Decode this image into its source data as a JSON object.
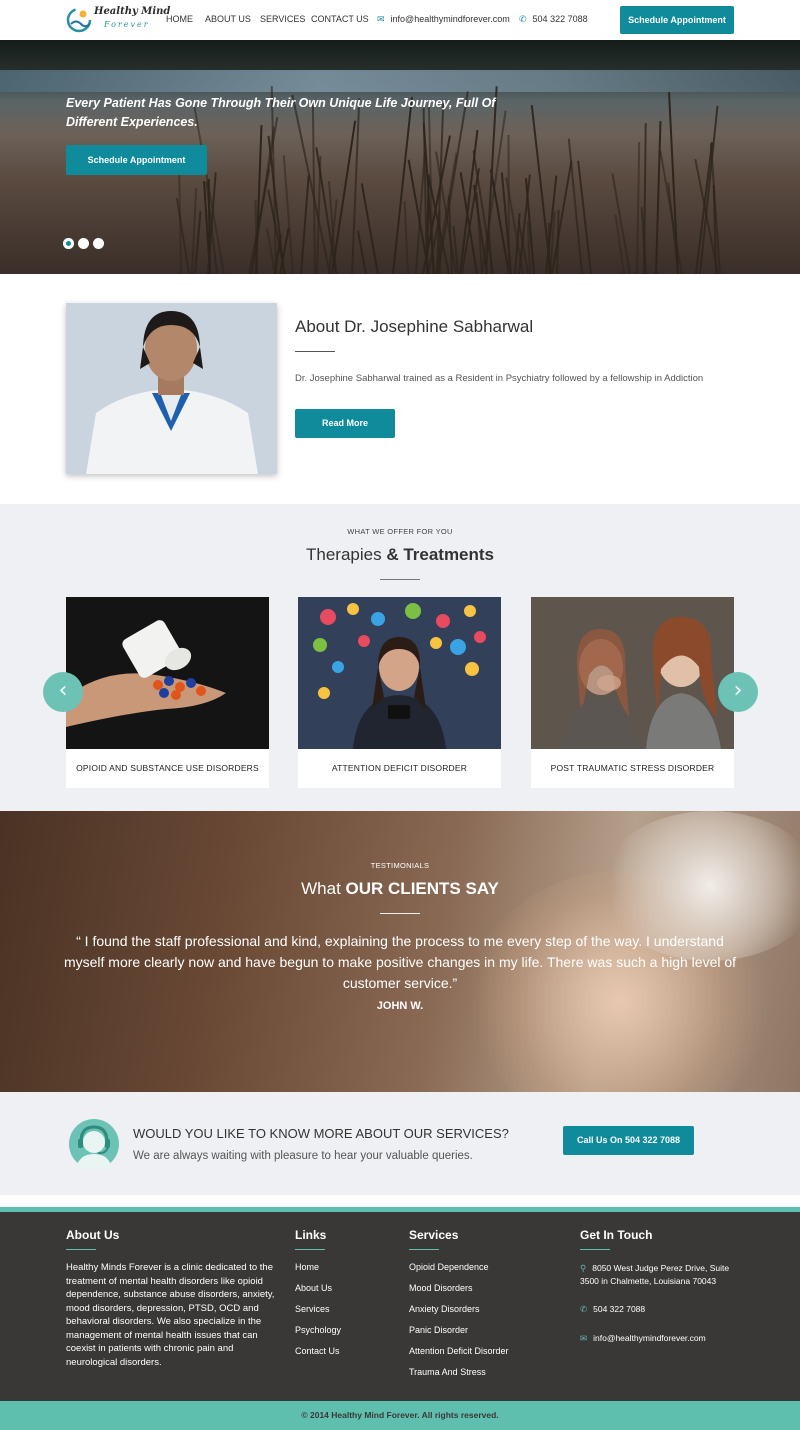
{
  "brand": {
    "line1": "Healthy Mind",
    "line2": "Forever"
  },
  "nav": {
    "links": [
      "HOME",
      "ABOUT US",
      "SERVICES",
      "CONTACT US"
    ],
    "email": "info@healthymindforever.com",
    "phone": "504 322 7088",
    "cta": "Schedule Appointment"
  },
  "hero": {
    "title": "Every Patient Has Gone Through Their Own Unique Life Journey, Full Of Different Experiences.",
    "cta": "Schedule Appointment",
    "slides": 3,
    "active_slide": 1
  },
  "about": {
    "title": "About Dr. Josephine Sabharwal",
    "text": "Dr. Josephine Sabharwal trained as a Resident in Psychiatry followed by a fellowship in Addiction",
    "cta": "Read More"
  },
  "therapies": {
    "kicker": "WHAT WE OFFER FOR YOU",
    "title_light": "Therapies ",
    "title_bold": "& Treatments",
    "cards": [
      {
        "label": "OPIOID AND SUBSTANCE USE DISORDERS"
      },
      {
        "label": "ATTENTION DEFICIT DISORDER"
      },
      {
        "label": "POST TRAUMATIC STRESS DISORDER"
      }
    ]
  },
  "testimonials": {
    "kicker": "TESTIMONIALS",
    "title_light": "What ",
    "title_bold": "OUR CLIENTS SAY",
    "quote": "“ I found the staff professional and kind, explaining the process to me every step of the way. I understand myself more clearly now and have begun to make positive changes in my life. There was such a high level of customer service.”",
    "author": "JOHN W."
  },
  "cta_strip": {
    "question": "WOULD YOU LIKE TO KNOW MORE ABOUT OUR SERVICES?",
    "sub": "We are always waiting with pleasure to hear your valuable queries.",
    "button": "Call Us On 504 322 7088"
  },
  "footer": {
    "about_head": "About Us",
    "about_text": "Healthy Minds Forever is a clinic dedicated to the treatment of mental health disorders like opioid dependence, substance abuse disorders, anxiety, mood disorders, depression, PTSD, OCD and behavioral disorders. We also specialize in the management of mental health issues that can coexist in patients with chronic pain and neurological disorders.",
    "links_head": "Links",
    "links": [
      "Home",
      "About Us",
      "Services",
      "Psychology",
      "Contact Us"
    ],
    "services_head": "Services",
    "services": [
      "Opioid Dependence",
      "Mood Disorders",
      "Anxiety Disorders",
      "Panic Disorder",
      "Attention Deficit Disorder",
      "Trauma And Stress"
    ],
    "contact_head": "Get In Touch",
    "address": "8050 West Judge Perez Drive, Suite 3500 in Chalmette, Louisiana 70043",
    "phone": "504 322 7088",
    "email": "info@healthymindforever.com",
    "copyright": "© 2014 Healthy Mind Forever. All rights reserved."
  },
  "colors": {
    "accent": "#0f8b9b",
    "mint": "#5fbfaf",
    "footer_bg": "#3a3837",
    "section_bg": "#eef0f4"
  }
}
